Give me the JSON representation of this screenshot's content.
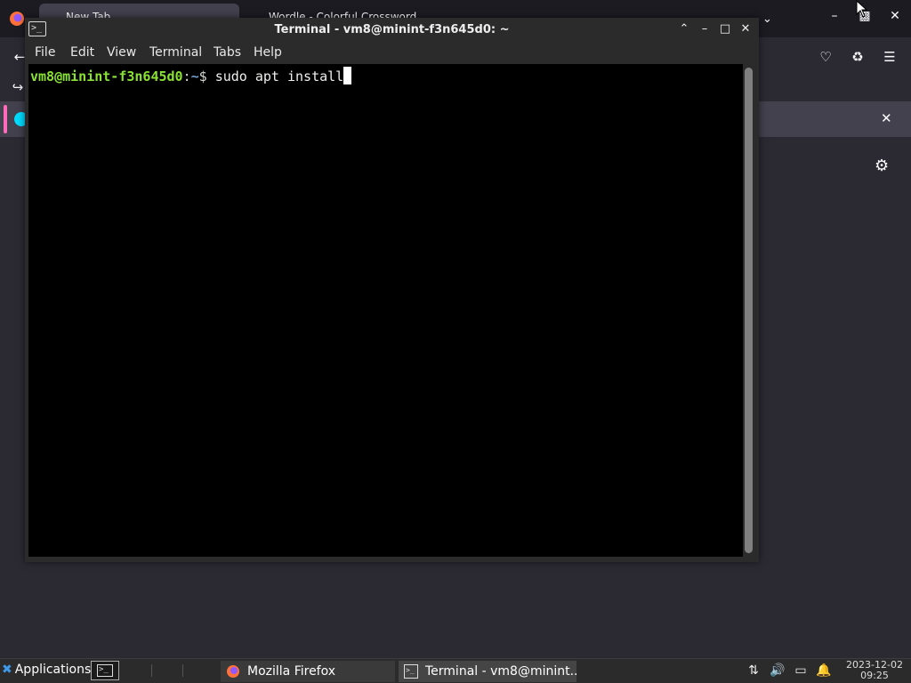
{
  "firefox": {
    "tabs": [
      {
        "label": "New Tab"
      },
      {
        "label": "Wordle - Colorful Crossword"
      }
    ],
    "colors": {
      "accent": "#ff6bba",
      "notice_icon": "#00ddff",
      "background": "#2b2a33"
    }
  },
  "terminal": {
    "title": "Terminal - vm8@minint-f3n645d0: ~",
    "menu": [
      "File",
      "Edit",
      "View",
      "Terminal",
      "Tabs",
      "Help"
    ],
    "prompt": {
      "user_host": "vm8@minint-f3n645d0",
      "separator": ":",
      "path": "~",
      "symbol": "$ ",
      "command": "sudo apt install"
    }
  },
  "taskbar": {
    "applications_label": "Applications",
    "tasks": [
      {
        "label": "Mozilla Firefox"
      },
      {
        "label": "Terminal - vm8@minint..."
      }
    ],
    "clock": {
      "date": "2023-12-02",
      "time": "09:25"
    }
  }
}
